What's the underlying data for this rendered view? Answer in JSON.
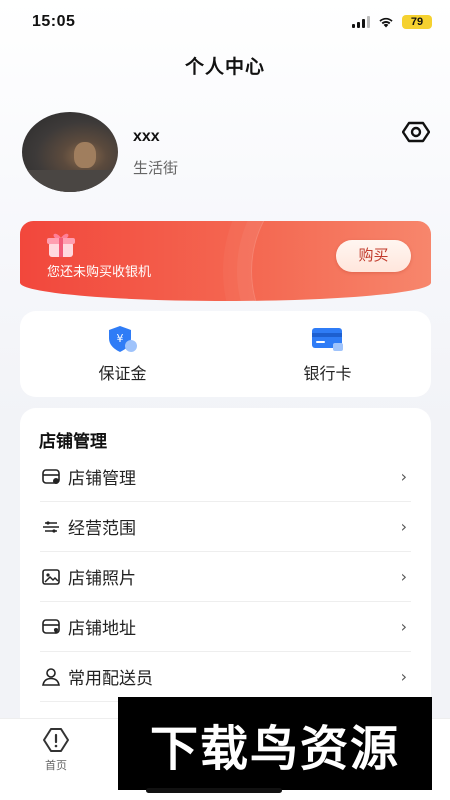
{
  "status_bar": {
    "time": "15:05",
    "battery": "79"
  },
  "header": {
    "title": "个人中心"
  },
  "profile": {
    "name": "xxx",
    "subtitle": "生活街"
  },
  "banner": {
    "text": "您还未购买收银机",
    "button": "购买",
    "colors": {
      "start": "#f2473c",
      "end": "#f7866c"
    }
  },
  "finance": {
    "items": [
      {
        "label": "保证金",
        "icon": "deposit-shield-icon"
      },
      {
        "label": "银行卡",
        "icon": "bank-card-icon"
      }
    ]
  },
  "store": {
    "title": "店铺管理",
    "items": [
      {
        "label": "店铺管理",
        "icon": "store-icon"
      },
      {
        "label": "经营范围",
        "icon": "business-scope-icon"
      },
      {
        "label": "店铺照片",
        "icon": "photo-icon"
      },
      {
        "label": "店铺地址",
        "icon": "store-location-icon"
      },
      {
        "label": "常用配送员",
        "icon": "courier-icon"
      }
    ],
    "arrow": "›"
  },
  "tabbar": {
    "items": [
      {
        "label": "首页",
        "icon": "home-icon"
      }
    ]
  },
  "watermark": {
    "text": "下载鸟资源"
  },
  "colors": {
    "accent": "#2f7cf6",
    "banner_red": "#f2473c"
  }
}
